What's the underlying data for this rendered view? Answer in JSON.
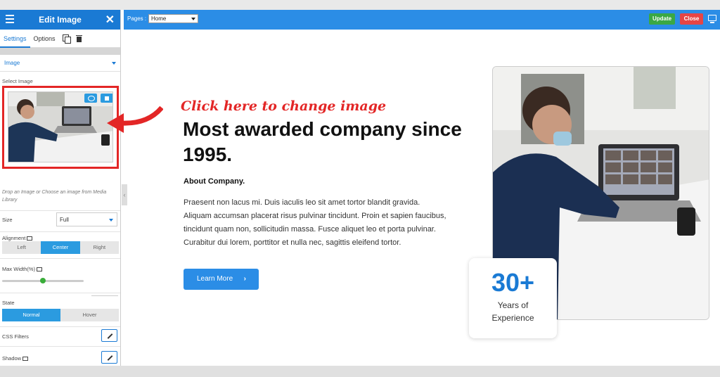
{
  "sidebar": {
    "title": "Edit Image",
    "close_glyph": "✕",
    "tabs": {
      "settings": "Settings",
      "options": "Options"
    },
    "section_label": "Image",
    "select_image_label": "Select Image",
    "hint": "Drop an Image or Choose an image from Media Library",
    "size": {
      "label": "Size",
      "value": "Full"
    },
    "alignment": {
      "label": "Alignment",
      "options": [
        "Left",
        "Center",
        "Right"
      ],
      "selected": "Center"
    },
    "max_width": {
      "label": "Max Width(%)",
      "value_fraction": 0.5
    },
    "state": {
      "label": "State",
      "options": [
        "Normal",
        "Hover"
      ],
      "selected": "Normal"
    },
    "css_filters_label": "CSS Filters",
    "shadow_label": "Shadow",
    "collapse_glyph": "‹"
  },
  "topbar": {
    "pages_label": "Pages :",
    "pages_value": "Home",
    "update_label": "Update",
    "close_label": "Close"
  },
  "canvas": {
    "annotation": "Click here to change image",
    "headline": "Most awarded company since 1995.",
    "about": "About Company.",
    "body": "Praesent non lacus mi. Duis iaculis leo sit amet tortor blandit gravida. Aliquam accumsan placerat risus pulvinar tincidunt. Proin et sapien faucibus, tincidunt quam non, sollicitudin massa. Fusce aliquet leo et porta pulvinar. Curabitur dui lorem, porttitor et nulla nec, sagittis eleifend tortor.",
    "button": "Learn More",
    "button_chevron": "›",
    "stat_number": "30+",
    "stat_line1": "Years of",
    "stat_line2": "Experience"
  },
  "colors": {
    "accent": "#2b8de6",
    "annotation": "#e32626",
    "update": "#3aa844",
    "close": "#e64545"
  }
}
